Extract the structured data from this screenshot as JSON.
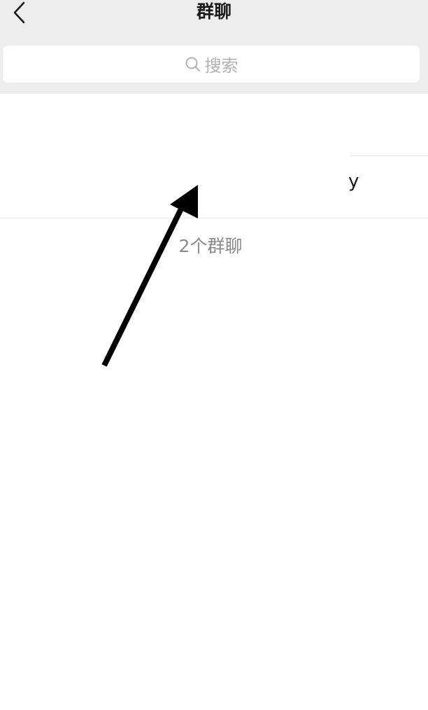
{
  "header": {
    "title": "群聊",
    "back_icon": "chevron-left-icon"
  },
  "search": {
    "placeholder": "搜索",
    "icon": "search-icon"
  },
  "groups": [
    {
      "name": ""
    },
    {
      "name": "y"
    }
  ],
  "footer": {
    "count_text": "2个群聊"
  },
  "annotation": {
    "icon": "arrow-annotation",
    "color": "#000000"
  },
  "colors": {
    "header_bg": "#ededed",
    "search_bg": "#ffffff",
    "placeholder": "#b2b2b2",
    "count_text": "#8a8a8a",
    "divider": "#e5e5e5"
  }
}
